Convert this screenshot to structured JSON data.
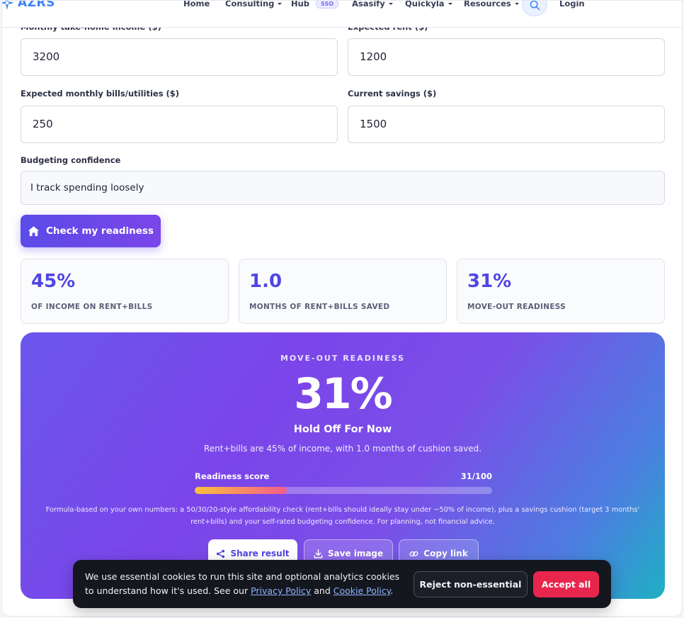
{
  "nav": {
    "logo_text": "AZRS",
    "items": [
      {
        "label": "Home"
      },
      {
        "label": "Consulting"
      },
      {
        "label": "Hub",
        "badge": "SSO"
      },
      {
        "label": "Asasify"
      },
      {
        "label": "Quickyla"
      },
      {
        "label": "Resources"
      }
    ],
    "login_label": "Login"
  },
  "form": {
    "income_label": "Monthly take-home income ($)",
    "income_value": "3200",
    "rent_label": "Expected rent ($)",
    "rent_value": "1200",
    "bills_label": "Expected monthly bills/utilities ($)",
    "bills_value": "250",
    "savings_label": "Current savings ($)",
    "savings_value": "1500",
    "confidence_label": "Budgeting confidence",
    "confidence_value": "I track spending loosely",
    "submit_label": "Check my readiness"
  },
  "stats": [
    {
      "value": "45%",
      "caption": "OF INCOME ON RENT+BILLS"
    },
    {
      "value": "1.0",
      "caption": "MONTHS OF RENT+BILLS SAVED"
    },
    {
      "value": "31%",
      "caption": "MOVE-OUT READINESS"
    }
  ],
  "result": {
    "kicker": "MOVE-OUT READINESS",
    "big_value": "31%",
    "verdict": "Hold Off For Now",
    "summary": "Rent+bills are 45% of income, with 1.0 months of cushion saved.",
    "score_label": "Readiness score",
    "score_text": "31/100",
    "score_fraction": 0.31,
    "note": "Formula-based on your own numbers: a 50/30/20-style affordability check (rent+bills should ideally stay under ~50% of income), plus a savings cushion (target 3 months' rent+bills) and your self-rated budgeting confidence. For planning, not financial advice.",
    "share_label": "Share result",
    "save_label": "Save image",
    "copy_label": "Copy link"
  },
  "cookie": {
    "text_before": "We use essential cookies to run this site and optional analytics cookies to understand how it's used. See our ",
    "privacy_link": "Privacy Policy",
    "text_and": " and ",
    "cookie_link": "Cookie Policy",
    "text_end": ".",
    "reject_label": "Reject non-essential",
    "accept_label": "Accept all"
  },
  "colors": {
    "accent": "#4f46e5",
    "brand_blue": "#3b82f6",
    "accept_red": "#e8264d"
  }
}
